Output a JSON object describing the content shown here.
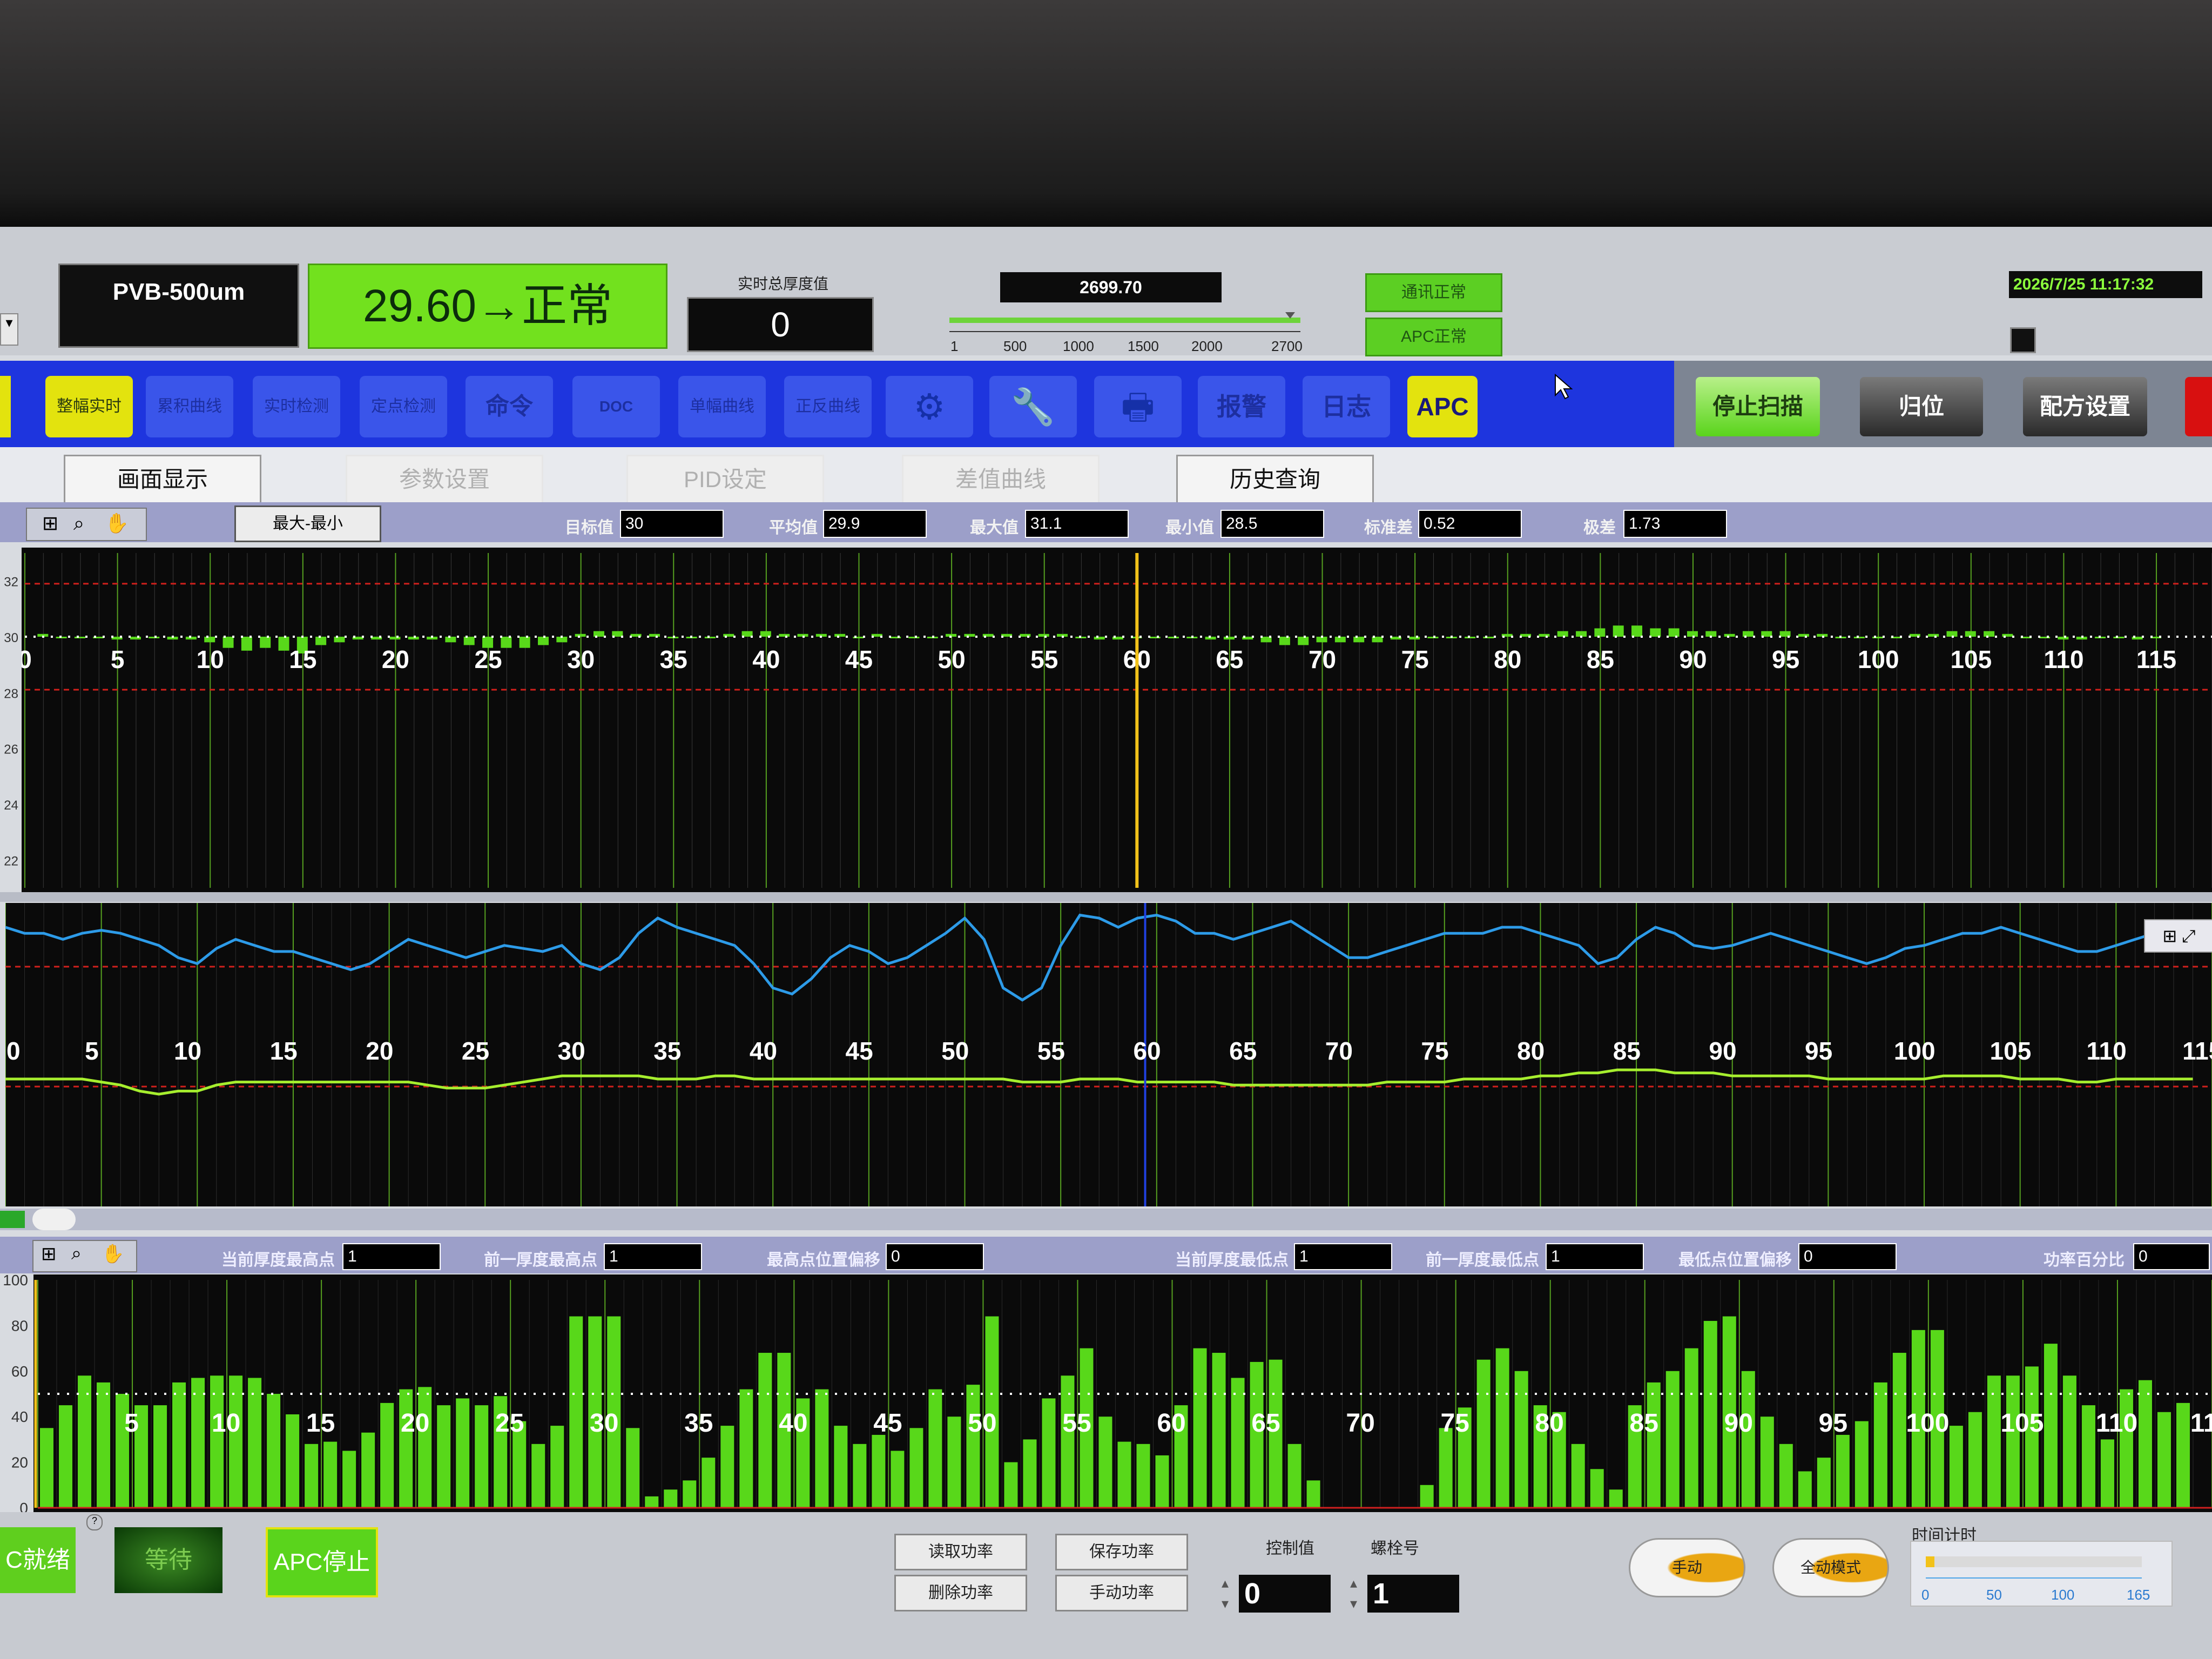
{
  "header": {
    "model": "PVB-500um",
    "status": "29.60→正常",
    "realtime_thickness_label": "实时总厚度值",
    "realtime_thickness_value": "0",
    "position_value": "2699.70",
    "position_ticks": [
      "1",
      "500",
      "1000",
      "1500",
      "2000",
      "2700"
    ],
    "comm_status": "通讯正常",
    "apc_status": "APC正常",
    "datetime": "2026/7/25 11:17:32"
  },
  "toolbar": {
    "buttons": [
      {
        "name": "整幅实时",
        "style": "yellow"
      },
      {
        "name": "累积曲线",
        "style": "blue"
      },
      {
        "name": "实时检测",
        "style": "blue"
      },
      {
        "name": "定点检测",
        "style": "blue"
      },
      {
        "name": "命令",
        "style": "blue"
      },
      {
        "name": "DOC",
        "style": "blue"
      },
      {
        "name": "单幅曲线",
        "style": "blue"
      },
      {
        "name": "正反曲线",
        "style": "blue"
      },
      {
        "name": "settings",
        "style": "blue"
      },
      {
        "name": "tools",
        "style": "blue"
      },
      {
        "name": "print",
        "style": "blue"
      },
      {
        "name": "报警",
        "style": "blue"
      },
      {
        "name": "日志",
        "style": "blue"
      },
      {
        "name": "APC",
        "style": "apc"
      }
    ],
    "stop_scan": "停止扫描",
    "home": "归位",
    "recipe": "配方设置"
  },
  "tabs": [
    {
      "label": "画面显示",
      "active": true
    },
    {
      "label": "参数设置",
      "active": false
    },
    {
      "label": "PID设定",
      "active": false
    },
    {
      "label": "差值曲线",
      "active": false
    },
    {
      "label": "历史查询",
      "active": true
    }
  ],
  "stats": {
    "minmax_button": "最大-最小",
    "target_label": "目标值",
    "target": "30",
    "avg_label": "平均值",
    "avg": "29.9",
    "max_label": "最大值",
    "max": "31.1",
    "min_label": "最小值",
    "min": "28.5",
    "std_label": "标准差",
    "std": "0.52",
    "range_label": "极差",
    "range": "1.73"
  },
  "profile_stats": {
    "cur_high_label": "当前厚度最高点",
    "cur_high": "1",
    "prev_high_label": "前一厚度最高点",
    "prev_high": "1",
    "high_offset_label": "最高点位置偏移",
    "high_offset": "0",
    "cur_low_label": "当前厚度最低点",
    "cur_low": "1",
    "prev_low_label": "前一厚度最低点",
    "prev_low": "1",
    "low_offset_label": "最低点位置偏移",
    "low_offset": "0",
    "power_pct_label": "功率百分比",
    "power_pct": "0"
  },
  "bottom": {
    "ready": "C就绪",
    "waiting": "等待",
    "apc_stop": "APC停止",
    "read_power": "读取功率",
    "save_power": "保存功率",
    "delete_power": "删除功率",
    "manual_power": "手动功率",
    "control_label": "控制值",
    "control_value": "0",
    "bolt_label": "螺栓号",
    "bolt_value": "1",
    "manual": "手动",
    "auto_mode": "全动模式",
    "timer_label": "时间计时",
    "timer_ticks": [
      "0",
      "50",
      "100",
      "165"
    ]
  },
  "colors": {
    "toolbar_blue": "#1e35de",
    "status_green": "#72e11e",
    "bar_green": "#58d81a",
    "curve_blue": "#2d9be8",
    "limit_red": "#d0201c",
    "cursor_yellow": "#f2c21a"
  },
  "chart_data": [
    {
      "type": "bar",
      "title": "",
      "x_ticks": [
        5,
        10,
        15,
        20,
        25,
        30,
        35,
        40,
        45,
        50,
        55,
        60,
        65,
        70,
        75,
        80,
        85,
        90,
        95,
        100,
        105,
        110,
        115
      ],
      "y_ticks": [
        "32",
        "30",
        "28",
        "26",
        "24",
        "22"
      ],
      "y_range": [
        21,
        33
      ],
      "baseline": 30,
      "upper_limit": 31.9,
      "lower_limit": 28.1,
      "cursor_x": 60,
      "values": [
        30.1,
        30.0,
        30.0,
        30.0,
        29.9,
        29.9,
        30.0,
        29.9,
        29.9,
        29.8,
        29.6,
        29.5,
        29.6,
        29.5,
        29.4,
        29.7,
        29.8,
        29.9,
        29.9,
        29.9,
        29.9,
        29.9,
        29.8,
        29.7,
        29.6,
        29.6,
        29.6,
        29.7,
        29.8,
        30.1,
        30.2,
        30.2,
        30.1,
        30.1,
        30.0,
        30.0,
        30.0,
        30.1,
        30.2,
        30.2,
        30.1,
        30.1,
        30.1,
        30.1,
        30.0,
        30.1,
        30.0,
        30.0,
        30.0,
        30.1,
        30.1,
        30.1,
        30.1,
        30.1,
        30.1,
        30.1,
        30.0,
        29.9,
        29.9,
        30.0,
        30.0,
        30.0,
        30.0,
        29.9,
        29.9,
        29.9,
        29.8,
        29.7,
        29.7,
        29.8,
        29.8,
        29.8,
        29.8,
        29.9,
        29.9,
        30.0,
        30.0,
        30.0,
        30.0,
        30.1,
        30.1,
        30.1,
        30.2,
        30.2,
        30.3,
        30.4,
        30.4,
        30.3,
        30.3,
        30.2,
        30.2,
        30.1,
        30.2,
        30.2,
        30.2,
        30.1,
        30.1,
        30.0,
        30.0,
        30.0,
        30.0,
        30.1,
        30.1,
        30.2,
        30.2,
        30.2,
        30.1,
        30.0,
        30.0,
        29.9,
        29.9,
        30.0,
        30.0,
        29.9,
        30.0
      ]
    },
    {
      "type": "line",
      "title": "",
      "x_ticks": [
        5,
        10,
        15,
        20,
        25,
        30,
        35,
        40,
        45,
        50,
        55,
        60,
        65,
        70,
        75,
        80,
        85,
        90,
        95,
        100,
        105,
        110,
        115
      ],
      "series": [
        {
          "values": [
            0.92,
            0.9,
            0.9,
            0.88,
            0.9,
            0.91,
            0.9,
            0.88,
            0.86,
            0.82,
            0.8,
            0.85,
            0.88,
            0.86,
            0.84,
            0.84,
            0.82,
            0.8,
            0.78,
            0.8,
            0.84,
            0.88,
            0.86,
            0.84,
            0.82,
            0.84,
            0.86,
            0.85,
            0.84,
            0.86,
            0.8,
            0.78,
            0.82,
            0.9,
            0.95,
            0.92,
            0.9,
            0.88,
            0.86,
            0.8,
            0.72,
            0.7,
            0.75,
            0.82,
            0.86,
            0.84,
            0.8,
            0.82,
            0.86,
            0.9,
            0.95,
            0.88,
            0.72,
            0.68,
            0.72,
            0.86,
            0.96,
            0.95,
            0.92,
            0.95,
            0.96,
            0.94,
            0.9,
            0.9,
            0.88,
            0.9,
            0.92,
            0.94,
            0.9,
            0.86,
            0.82,
            0.82,
            0.84,
            0.86,
            0.88,
            0.9,
            0.9,
            0.9,
            0.92,
            0.92,
            0.9,
            0.88,
            0.86,
            0.8,
            0.82,
            0.88,
            0.92,
            0.9,
            0.86,
            0.85,
            0.86,
            0.88,
            0.9,
            0.88,
            0.86,
            0.84,
            0.82,
            0.8,
            0.82,
            0.85,
            0.86,
            0.88,
            0.9,
            0.9,
            0.92,
            0.9,
            0.88,
            0.86,
            0.84,
            0.84,
            0.86,
            0.88,
            0.9,
            0.9,
            0.9
          ]
        },
        {
          "values": [
            0.42,
            0.42,
            0.42,
            0.42,
            0.42,
            0.41,
            0.4,
            0.38,
            0.37,
            0.38,
            0.38,
            0.4,
            0.41,
            0.41,
            0.41,
            0.41,
            0.41,
            0.41,
            0.41,
            0.41,
            0.41,
            0.41,
            0.4,
            0.39,
            0.39,
            0.39,
            0.4,
            0.41,
            0.42,
            0.43,
            0.43,
            0.43,
            0.43,
            0.43,
            0.42,
            0.42,
            0.42,
            0.43,
            0.43,
            0.42,
            0.42,
            0.42,
            0.42,
            0.42,
            0.42,
            0.42,
            0.42,
            0.42,
            0.42,
            0.42,
            0.42,
            0.42,
            0.42,
            0.41,
            0.41,
            0.41,
            0.42,
            0.42,
            0.42,
            0.41,
            0.41,
            0.41,
            0.41,
            0.41,
            0.4,
            0.4,
            0.4,
            0.4,
            0.4,
            0.4,
            0.4,
            0.4,
            0.41,
            0.41,
            0.41,
            0.41,
            0.42,
            0.42,
            0.42,
            0.42,
            0.43,
            0.43,
            0.44,
            0.44,
            0.45,
            0.45,
            0.45,
            0.44,
            0.44,
            0.44,
            0.43,
            0.43,
            0.43,
            0.43,
            0.43,
            0.42,
            0.42,
            0.42,
            0.42,
            0.42,
            0.42,
            0.43,
            0.43,
            0.43,
            0.43,
            0.42,
            0.42,
            0.42,
            0.41,
            0.41,
            0.42,
            0.42,
            0.42,
            0.42,
            0.42
          ]
        }
      ]
    },
    {
      "type": "bar",
      "title": "",
      "x_ticks": [
        5,
        10,
        15,
        20,
        25,
        30,
        35,
        40,
        45,
        50,
        55,
        60,
        65,
        70,
        75,
        80,
        85,
        90,
        95,
        100,
        105,
        110,
        115
      ],
      "y_ticks": [
        "100",
        "80",
        "60",
        "40",
        "20",
        "0"
      ],
      "y_range": [
        0,
        100
      ],
      "reference": 50,
      "values": [
        35,
        45,
        58,
        55,
        50,
        45,
        45,
        55,
        57,
        58,
        58,
        57,
        50,
        41,
        28,
        29,
        25,
        33,
        46,
        52,
        53,
        45,
        48,
        45,
        49,
        38,
        28,
        36,
        84,
        84,
        84,
        35,
        5,
        8,
        12,
        22,
        36,
        52,
        68,
        68,
        48,
        52,
        36,
        28,
        32,
        25,
        35,
        52,
        40,
        54,
        84,
        20,
        30,
        48,
        58,
        70,
        40,
        29,
        28,
        23,
        45,
        70,
        68,
        57,
        64,
        65,
        28,
        12,
        0,
        0,
        0,
        0,
        0,
        10,
        35,
        44,
        65,
        70,
        60,
        45,
        42,
        28,
        17,
        8,
        45,
        55,
        60,
        70,
        82,
        84,
        60,
        40,
        28,
        16,
        22,
        32,
        38,
        55,
        68,
        78,
        78,
        36,
        42,
        58,
        58,
        62,
        72,
        58,
        45,
        30,
        52,
        56,
        42,
        46
      ]
    }
  ]
}
